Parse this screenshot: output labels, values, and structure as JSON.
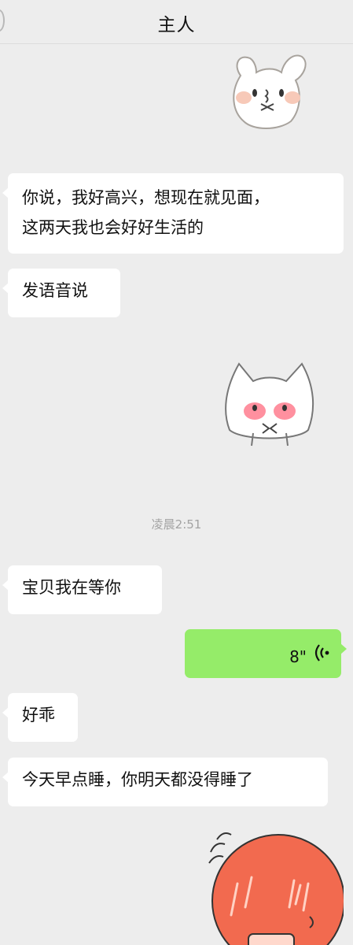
{
  "header": {
    "title": "主人"
  },
  "messages": [
    {
      "side": "left",
      "type": "text",
      "lines": [
        "你说，我好高兴，想现在就见面，",
        "这两天我也会好好生活的"
      ]
    },
    {
      "side": "left",
      "type": "text",
      "text": "发语音说"
    },
    {
      "type": "timestamp",
      "text": "凌晨2:51"
    },
    {
      "side": "left",
      "type": "text",
      "text": "宝贝我在等你"
    },
    {
      "side": "right",
      "type": "voice",
      "duration": "8\""
    },
    {
      "side": "left",
      "type": "text",
      "text": "好乖"
    },
    {
      "side": "left",
      "type": "text",
      "text": "今天早点睡，你明天都没得睡了"
    }
  ],
  "stickers": [
    {
      "name": "bunny-sticker",
      "side": "right"
    },
    {
      "name": "cat-sticker",
      "side": "right"
    },
    {
      "name": "red-face-sticker",
      "side": "right"
    }
  ],
  "colors": {
    "background": "#ededed",
    "bubble_left": "#ffffff",
    "bubble_right": "#95ec69",
    "timestamp": "#a3a3a3"
  }
}
